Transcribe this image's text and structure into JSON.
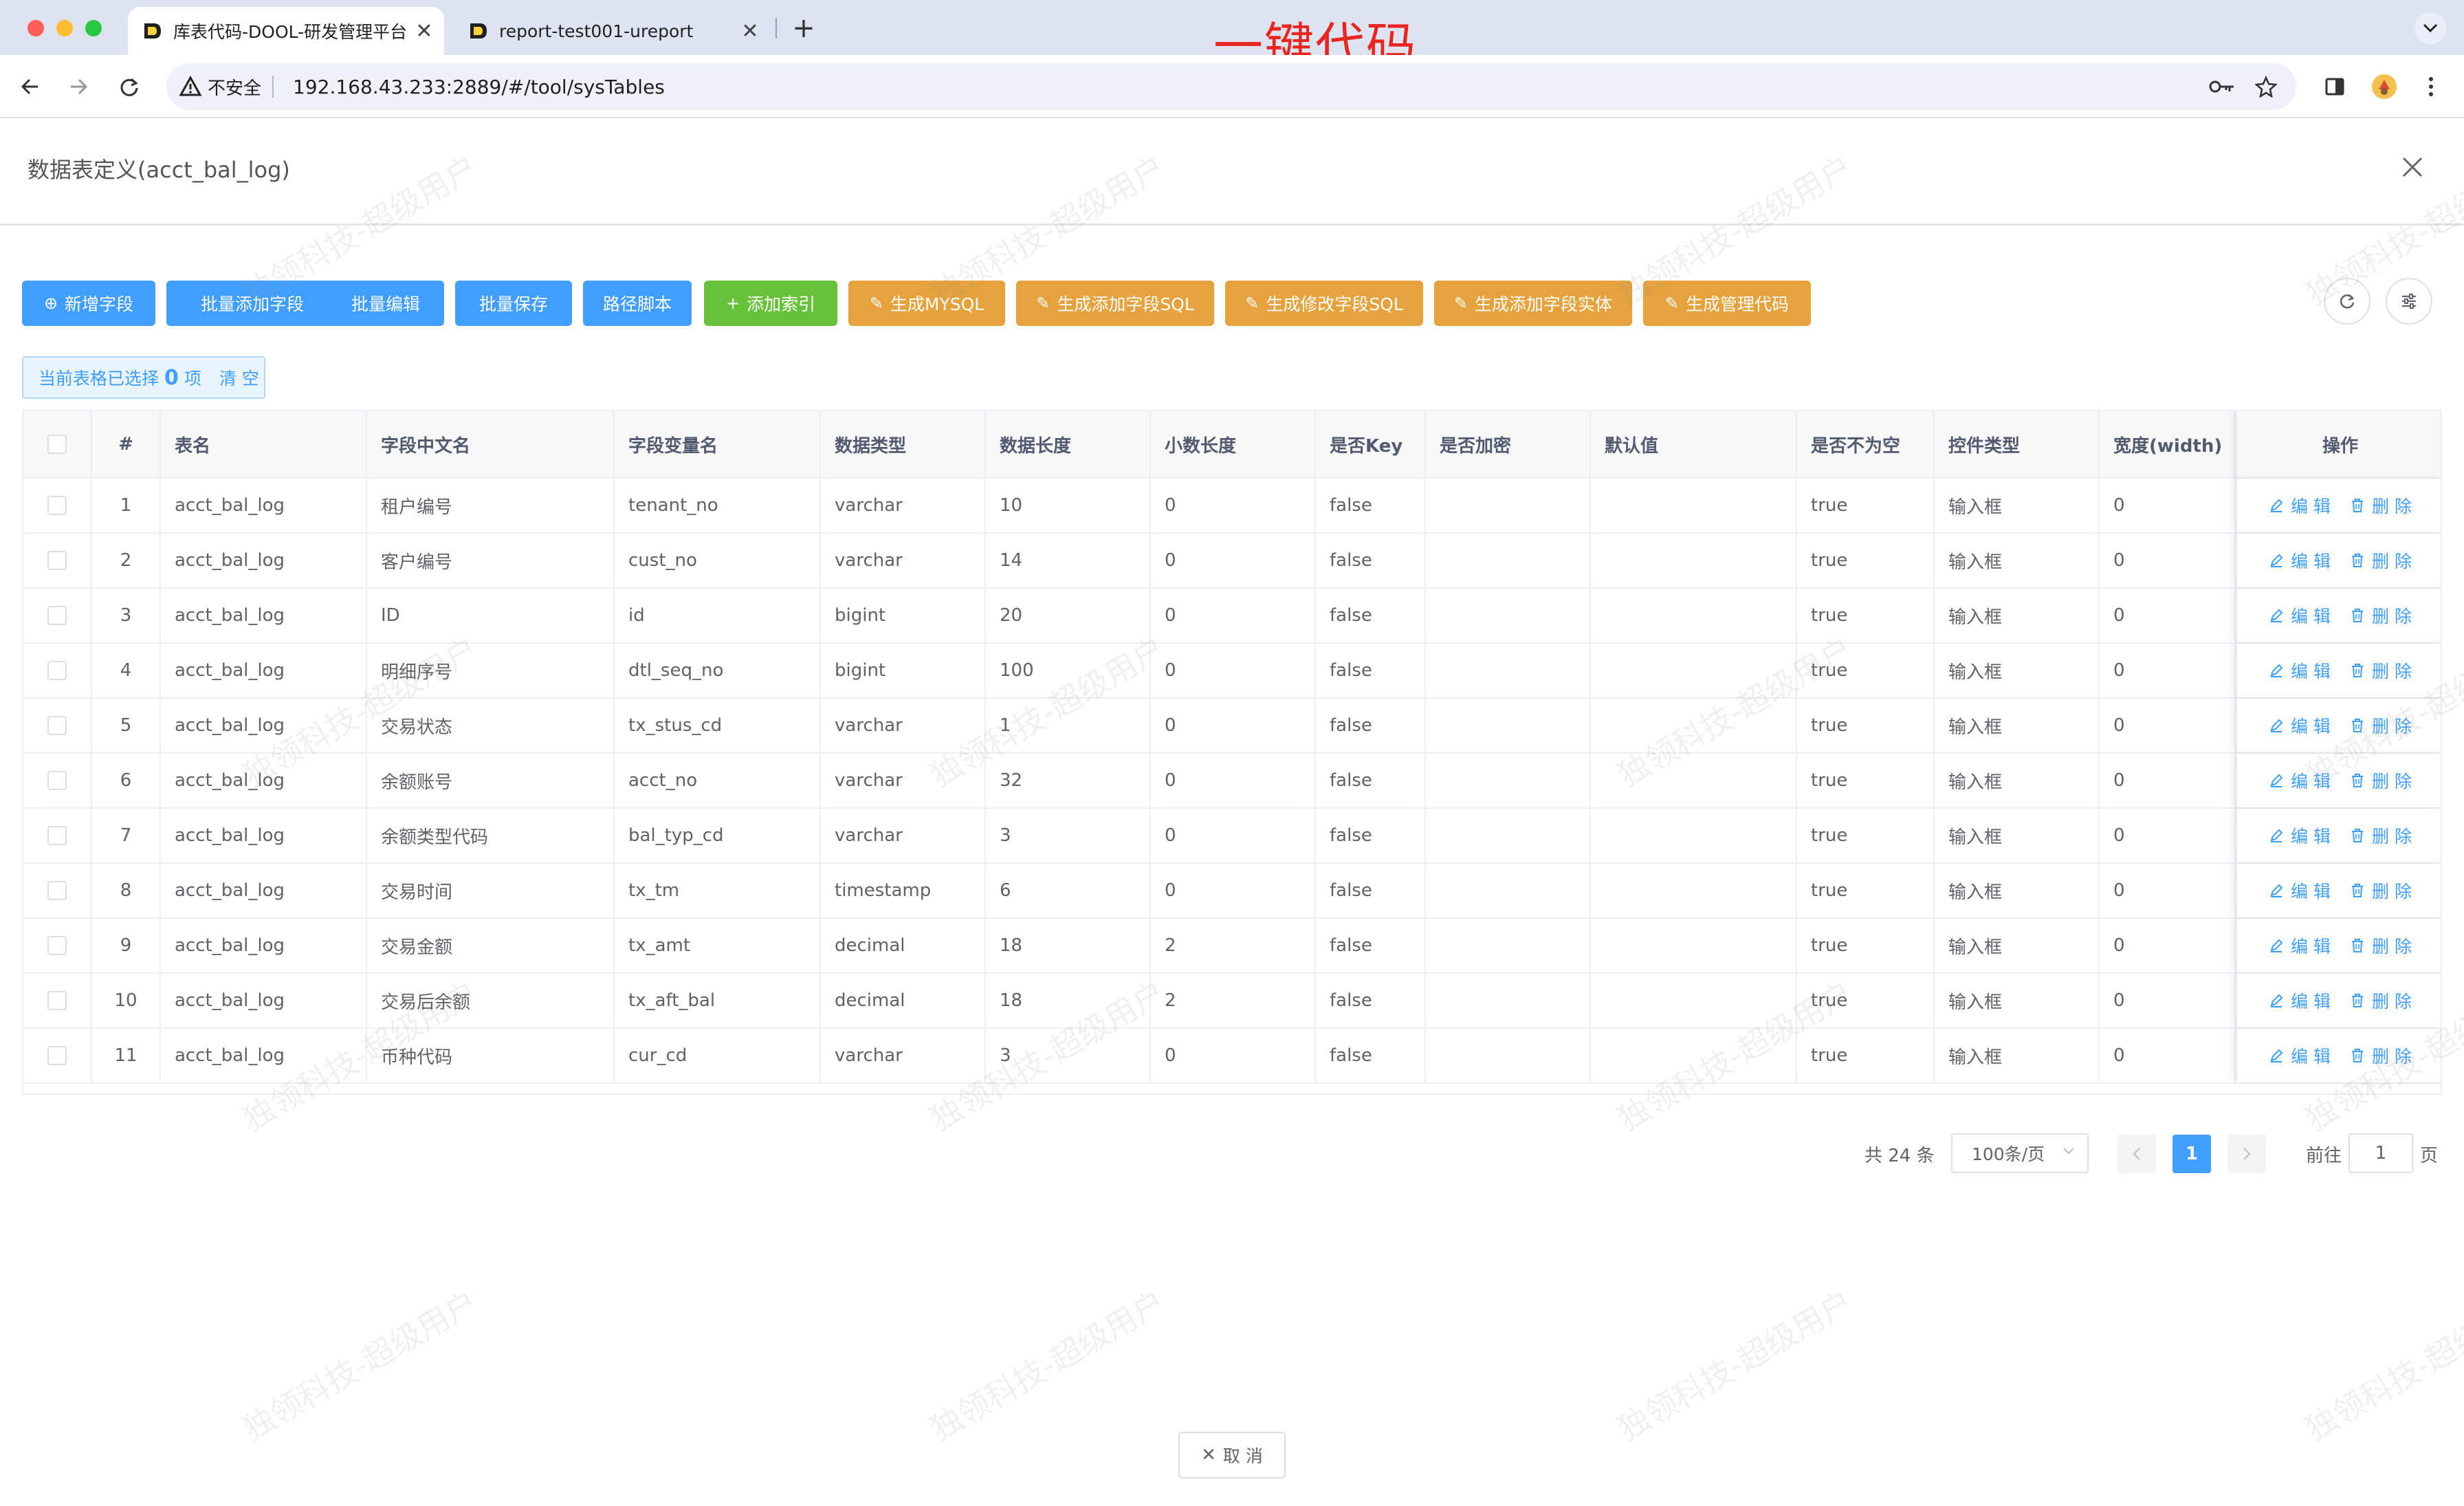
{
  "browser": {
    "tabs": [
      {
        "label": "库表代码-DOOL-研发管理平台",
        "active": true
      },
      {
        "label": "report-test001-ureport",
        "active": false
      }
    ],
    "overlay_title": "一键代码",
    "security_label": "不安全",
    "url": "192.168.43.233:2889/#/tool/sysTables"
  },
  "dialog": {
    "title": "数据表定义(acct_bal_log)",
    "cancel_label": "取 消"
  },
  "toolbar": {
    "buttons": [
      {
        "label": "新增字段",
        "color": "#409eff"
      },
      {
        "label": "批量添加字段",
        "color": "#409eff"
      },
      {
        "label": "批量编辑",
        "color": "#409eff"
      },
      {
        "label": "批量保存",
        "color": "#409eff"
      },
      {
        "label": "路径脚本",
        "color": "#409eff"
      },
      {
        "label": "添加索引",
        "color": "#67c23a"
      },
      {
        "label": "生成MYSQL",
        "color": "#e6a23c"
      },
      {
        "label": "生成添加字段SQL",
        "color": "#e6a23c"
      },
      {
        "label": "生成修改字段SQL",
        "color": "#e6a23c"
      },
      {
        "label": "生成添加字段实体",
        "color": "#e6a23c"
      },
      {
        "label": "生成管理代码",
        "color": "#e6a23c"
      }
    ]
  },
  "selection": {
    "prefix": "当前表格已选择",
    "count": "0",
    "suffix": "项",
    "clear_label": "清 空"
  },
  "table": {
    "columns": [
      "#",
      "表名",
      "字段中文名",
      "字段变量名",
      "数据类型",
      "数据长度",
      "小数长度",
      "是否Key",
      "是否加密",
      "默认值",
      "是否不为空",
      "控件类型",
      "宽度(width)",
      "操作"
    ],
    "edit_label": "编 辑",
    "delete_label": "删 除",
    "rows": [
      [
        "1",
        "acct_bal_log",
        "租户编号",
        "tenant_no",
        "varchar",
        "10",
        "0",
        "false",
        "",
        "",
        "true",
        "输入框",
        "0"
      ],
      [
        "2",
        "acct_bal_log",
        "客户编号",
        "cust_no",
        "varchar",
        "14",
        "0",
        "false",
        "",
        "",
        "true",
        "输入框",
        "0"
      ],
      [
        "3",
        "acct_bal_log",
        "ID",
        "id",
        "bigint",
        "20",
        "0",
        "false",
        "",
        "",
        "true",
        "输入框",
        "0"
      ],
      [
        "4",
        "acct_bal_log",
        "明细序号",
        "dtl_seq_no",
        "bigint",
        "100",
        "0",
        "false",
        "",
        "",
        "true",
        "输入框",
        "0"
      ],
      [
        "5",
        "acct_bal_log",
        "交易状态",
        "tx_stus_cd",
        "varchar",
        "1",
        "0",
        "false",
        "",
        "",
        "true",
        "输入框",
        "0"
      ],
      [
        "6",
        "acct_bal_log",
        "余额账号",
        "acct_no",
        "varchar",
        "32",
        "0",
        "false",
        "",
        "",
        "true",
        "输入框",
        "0"
      ],
      [
        "7",
        "acct_bal_log",
        "余额类型代码",
        "bal_typ_cd",
        "varchar",
        "3",
        "0",
        "false",
        "",
        "",
        "true",
        "输入框",
        "0"
      ],
      [
        "8",
        "acct_bal_log",
        "交易时间",
        "tx_tm",
        "timestamp",
        "6",
        "0",
        "false",
        "",
        "",
        "true",
        "输入框",
        "0"
      ],
      [
        "9",
        "acct_bal_log",
        "交易金额",
        "tx_amt",
        "decimal",
        "18",
        "2",
        "false",
        "",
        "",
        "true",
        "输入框",
        "0"
      ],
      [
        "10",
        "acct_bal_log",
        "交易后余额",
        "tx_aft_bal",
        "decimal",
        "18",
        "2",
        "false",
        "",
        "",
        "true",
        "输入框",
        "0"
      ],
      [
        "11",
        "acct_bal_log",
        "币种代码",
        "cur_cd",
        "varchar",
        "3",
        "0",
        "false",
        "",
        "",
        "true",
        "输入框",
        "0"
      ]
    ]
  },
  "pagination": {
    "total": "共 24 条",
    "page_size": "100条/页",
    "current_page": "1",
    "goto_label": "前往",
    "goto_value": "1",
    "goto_suffix": "页"
  },
  "watermark": "独领科技-超级用户"
}
